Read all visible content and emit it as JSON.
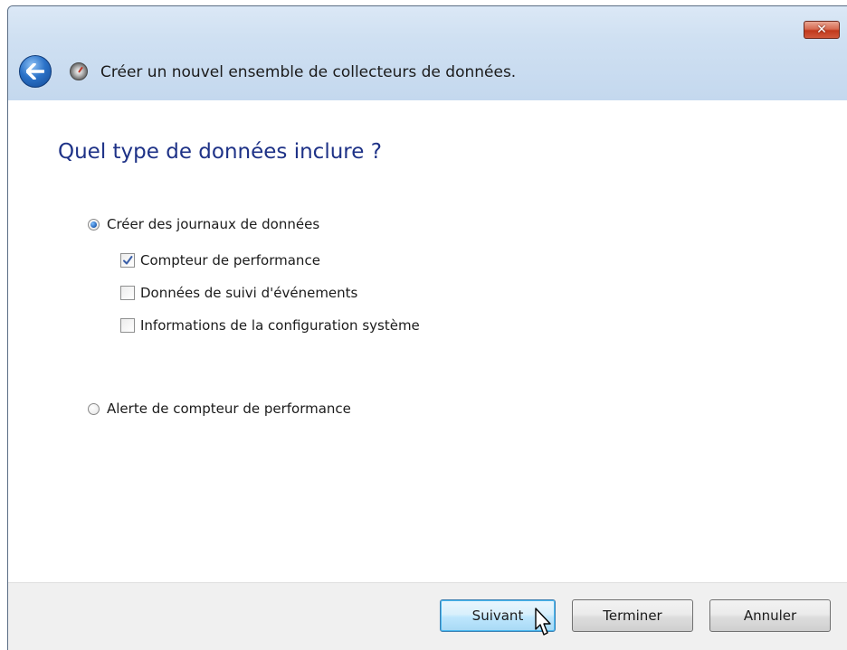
{
  "window": {
    "title": "Créer un nouvel ensemble de collecteurs de données.",
    "close_icon": "close-icon",
    "back_icon": "back-arrow-icon",
    "app_icon": "performance-monitor-icon"
  },
  "page": {
    "heading": "Quel type de données inclure ?"
  },
  "options": {
    "create_logs": {
      "label": "Créer des journaux de données",
      "selected": true
    },
    "perf_alert": {
      "label": "Alerte de compteur de performance",
      "selected": false
    }
  },
  "log_types": [
    {
      "label": "Compteur de performance",
      "checked": true
    },
    {
      "label": "Données de suivi d'événements",
      "checked": false
    },
    {
      "label": "Informations de la configuration système",
      "checked": false
    }
  ],
  "buttons": {
    "next": "Suivant",
    "finish": "Terminer",
    "cancel": "Annuler"
  },
  "colors": {
    "heading": "#1e3287",
    "title_bar": "#cfe0f2",
    "close_button": "#c1391c",
    "footer": "#f0f0f0"
  }
}
